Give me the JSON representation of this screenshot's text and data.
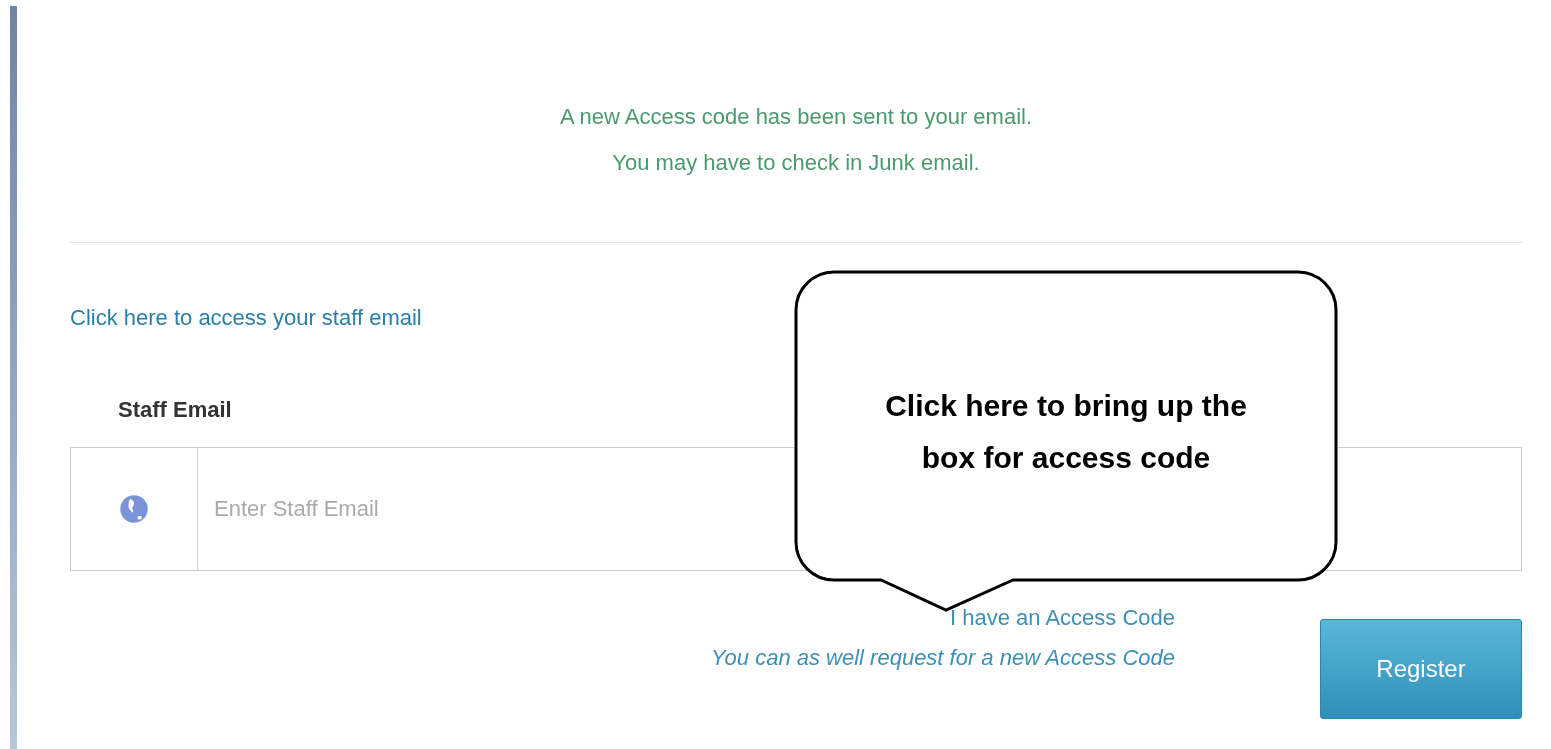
{
  "notice": [
    "A new Access code has been sent to your email.",
    "You may have to check in Junk email."
  ],
  "staff_email_link": "Click here to access your staff email",
  "staff_email": {
    "label": "Staff Email",
    "placeholder": "Enter Staff Email"
  },
  "links": [
    {
      "text": "I have an Access Code",
      "italic": false
    },
    {
      "text": "You can as well request for a new Access Code",
      "italic": true
    }
  ],
  "register_button": "Register",
  "callout": {
    "text": "Click here to bring up the box for access code"
  }
}
